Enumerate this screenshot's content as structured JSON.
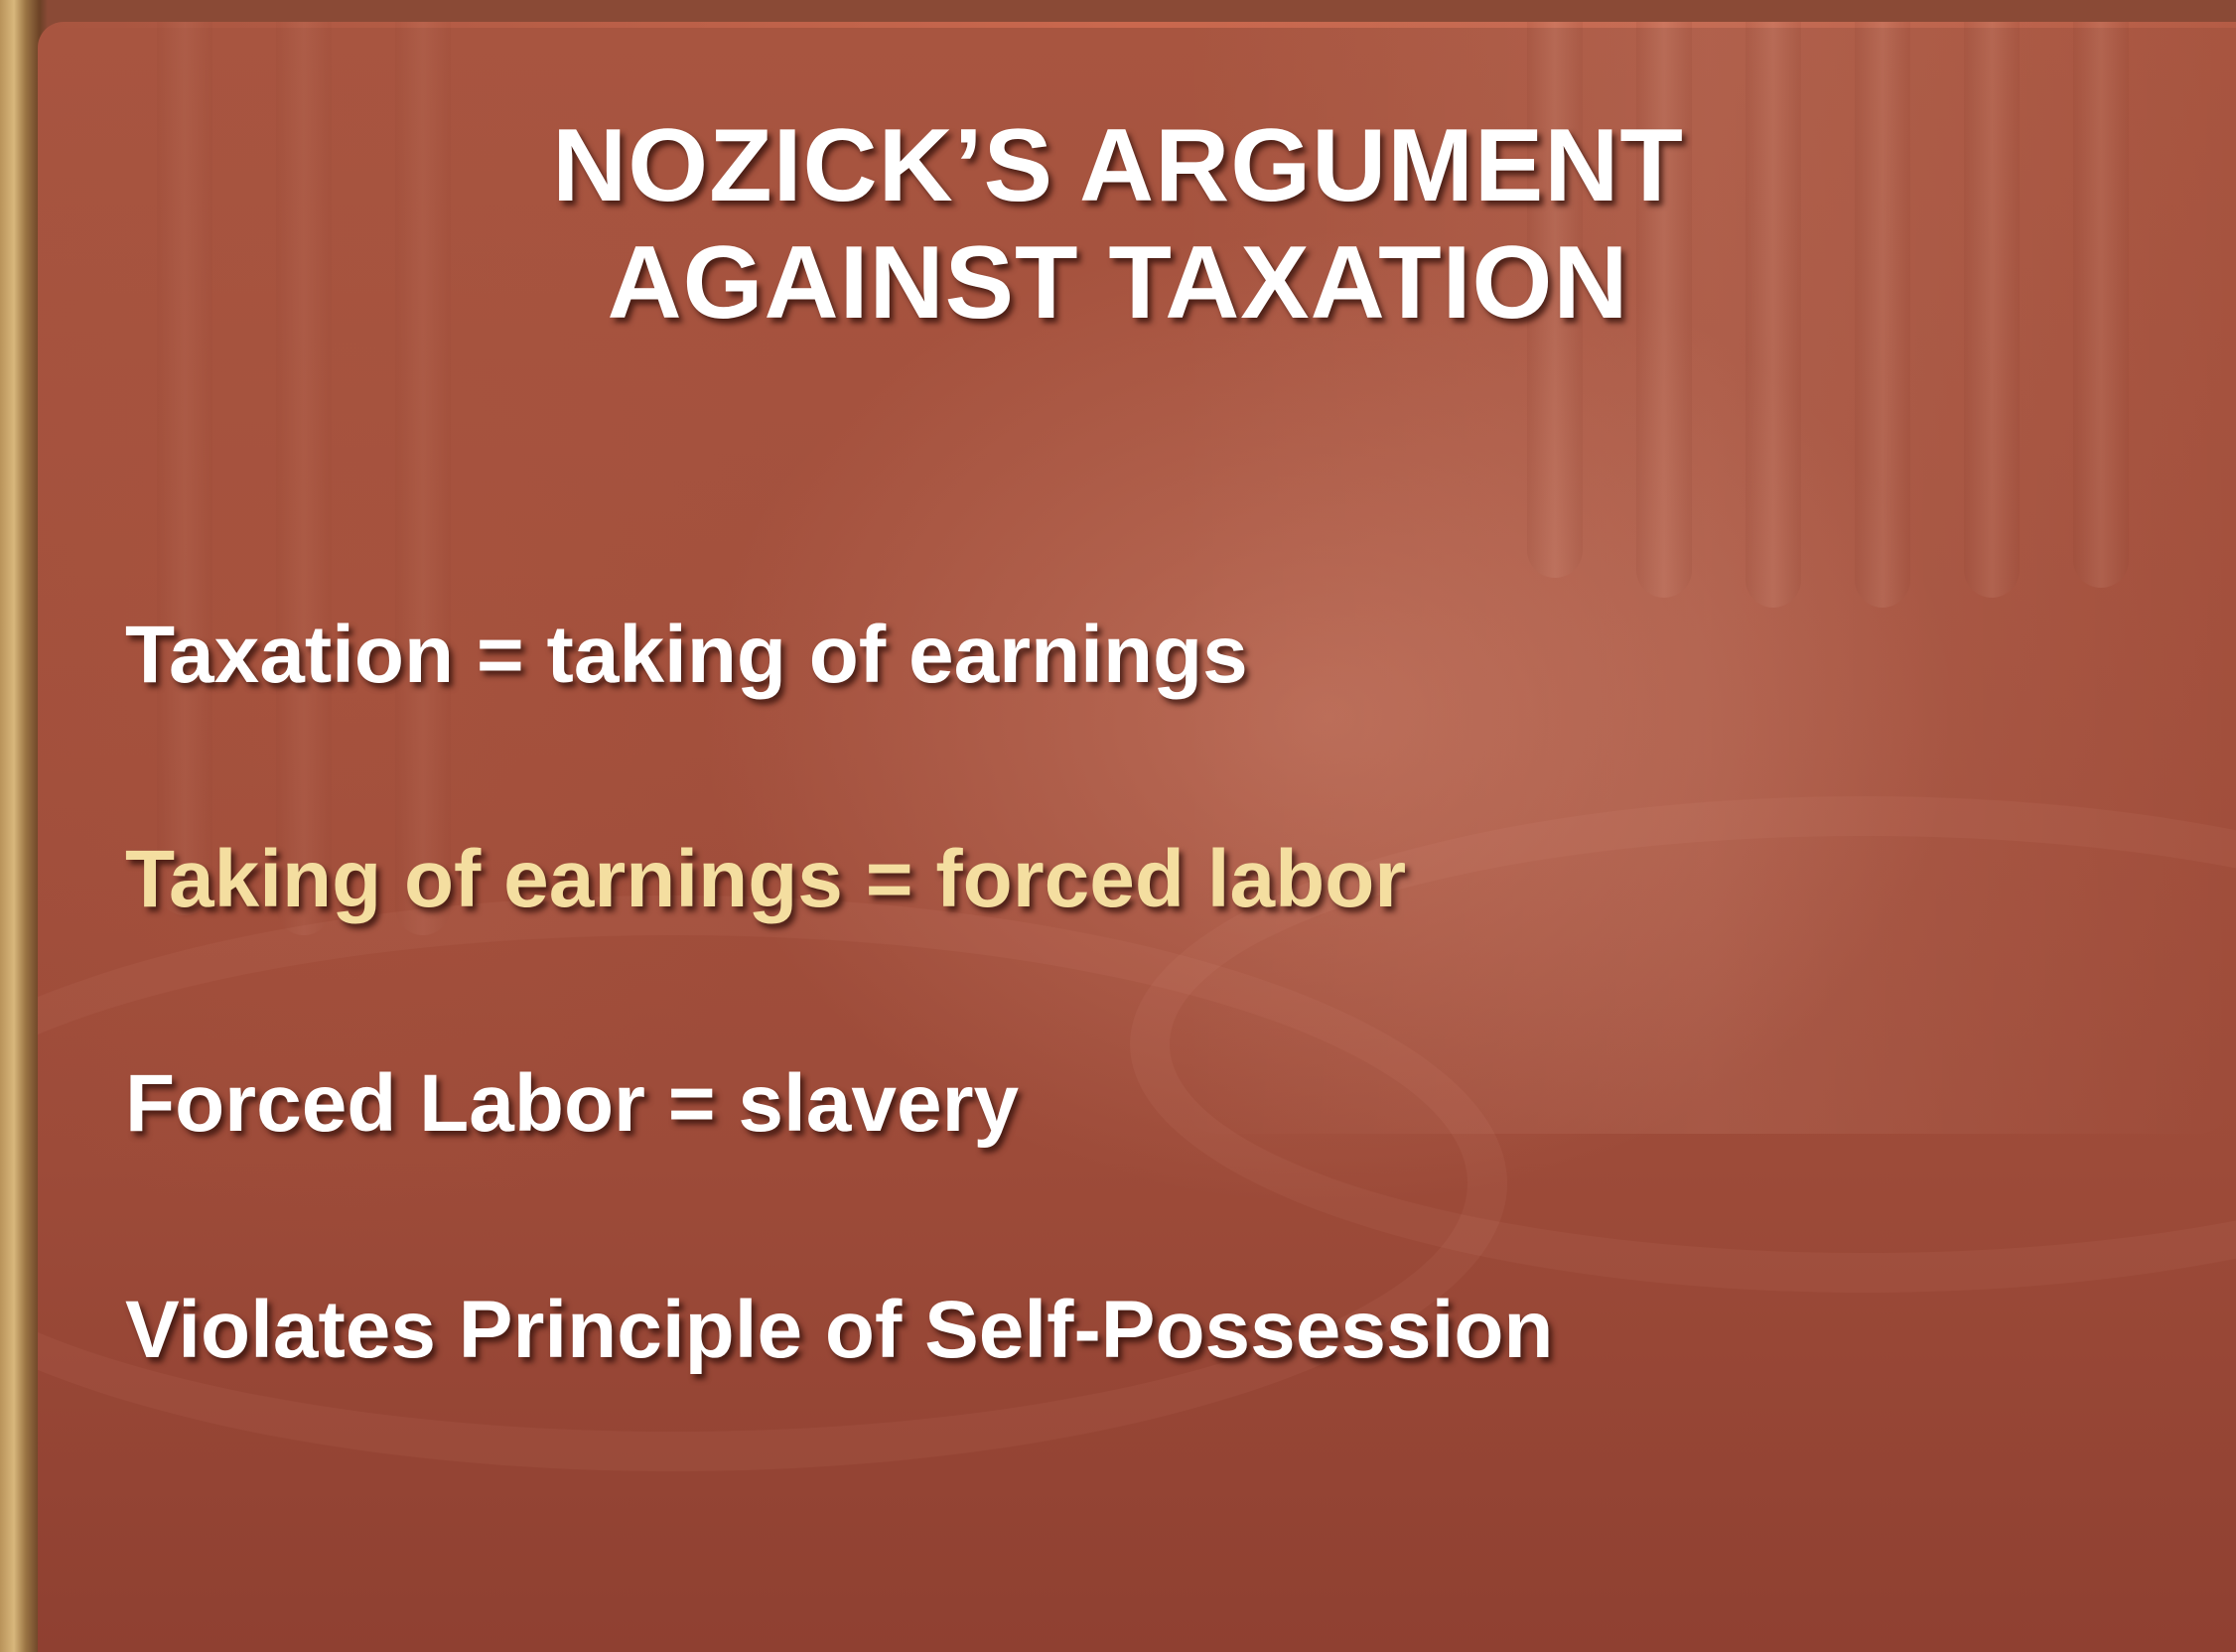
{
  "slide": {
    "title_lines": [
      "NOZICK’S ARGUMENT",
      "AGAINST TAXATION"
    ],
    "points": [
      {
        "text": "Taxation = taking of earnings",
        "highlight": false
      },
      {
        "text": "Taking of earnings = forced labor",
        "highlight": true
      },
      {
        "text": "Forced Labor = slavery",
        "highlight": false
      },
      {
        "text": "Violates Principle of Self-Possession",
        "highlight": false
      }
    ]
  },
  "colors": {
    "background": "#a24f3c",
    "text": "#ffffff",
    "highlight_text": "#f4dea0"
  }
}
